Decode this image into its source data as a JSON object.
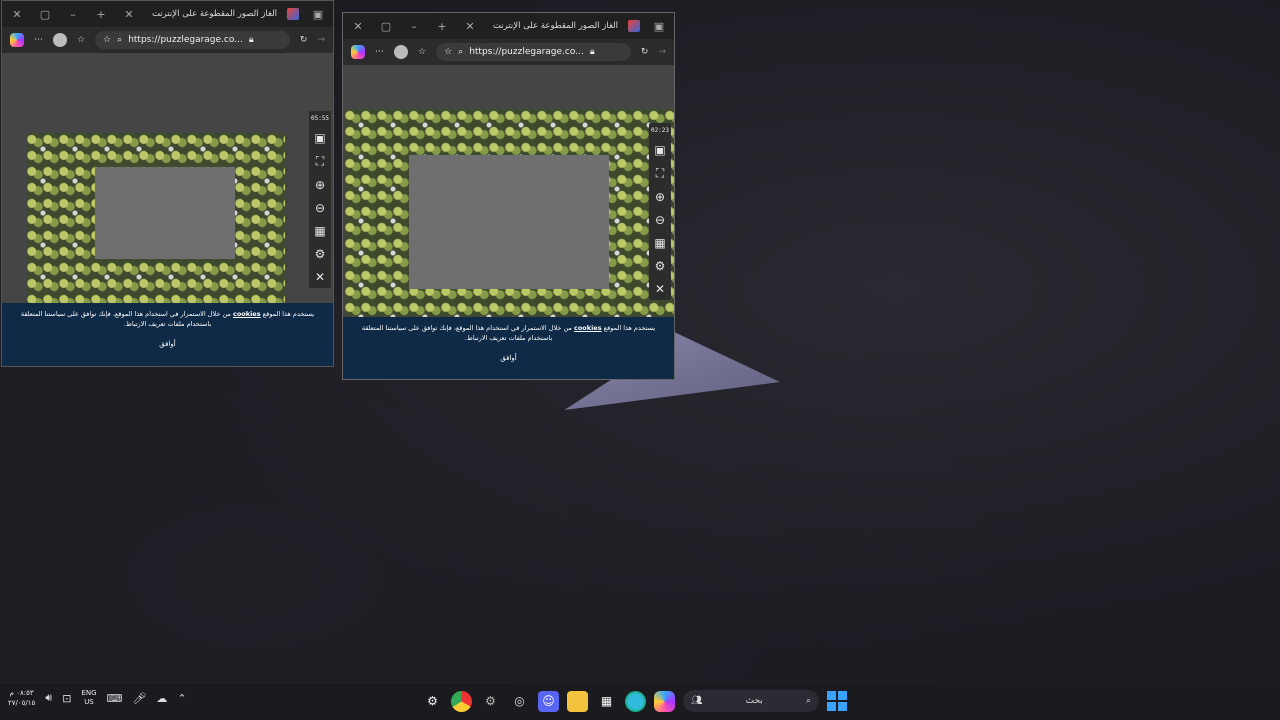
{
  "window1": {
    "tab_title": "ألغاز الصور المقطوعة على الإنترنت",
    "url": "https://puzzlegarage.co...",
    "timer": "05:55",
    "cookie_text_before": "يستخدم هذا الموقع",
    "cookie_link": "cookies",
    "cookie_text_after": "من خلال الاستمرار في استخدام هذا الموقع، فإنك توافق على سياستنا المتعلقة باستخدام ملفات تعريف الارتباط.",
    "cookie_button": "أوافق"
  },
  "window2": {
    "tab_title": "ألغاز الصور المقطوعة على الإنترنت",
    "url": "https://puzzlegarage.co...",
    "timer": "02:23",
    "cookie_text_before": "يستخدم هذا الموقع",
    "cookie_link": "cookies",
    "cookie_text_after": "من خلال الاستمرار في استخدام هذا الموقع، فإنك توافق على سياستنا المتعلقة باستخدام ملفات تعريف الارتباط.",
    "cookie_button": "أوافق"
  },
  "taskbar": {
    "time": "٠٨:٥٣ م",
    "date": "٢٧/٠٥/١٥",
    "lang_line1": "ENG",
    "lang_line2": "US",
    "search_placeholder": "بحث"
  },
  "colors": {
    "cookie_bg": "#0e2a46",
    "windows_blue": "#3aa3ff"
  }
}
